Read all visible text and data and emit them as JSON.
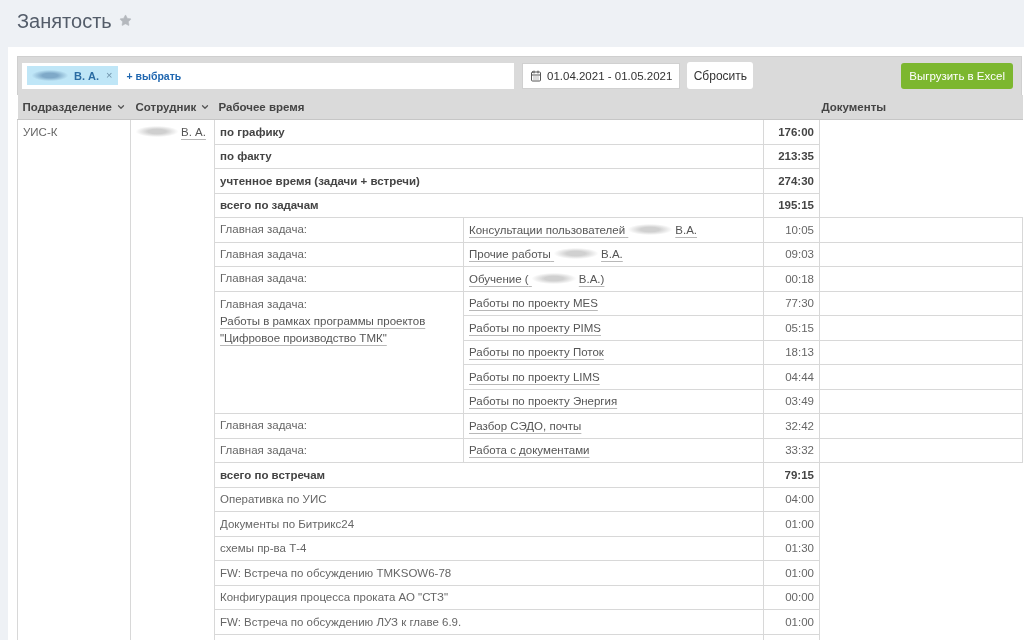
{
  "page": {
    "title": "Занятость",
    "favorite": false
  },
  "toolbar": {
    "filter": {
      "chips": [
        {
          "name_end": "В. А.",
          "redacted": true,
          "remove": "×"
        }
      ],
      "add_link": "+ выбрать"
    },
    "date_range": "01.04.2021 - 01.05.2021",
    "reset_button": "Сбросить",
    "export_button": "Выгрузить в Excel"
  },
  "table": {
    "columns": [
      {
        "label": "Подразделение",
        "sortable": true
      },
      {
        "label": "Сотрудник",
        "sortable": true
      },
      {
        "label": "Рабочее время",
        "sortable": false
      },
      {
        "label": "Документы",
        "sortable": false
      }
    ],
    "department": "УИС-К",
    "employee": {
      "name_end": "В. А.",
      "redacted": true
    },
    "rows": [
      {
        "kind": "total",
        "label": "по графику",
        "time": "176:00"
      },
      {
        "kind": "total",
        "label": "по факту",
        "time": "213:35"
      },
      {
        "kind": "total",
        "label": "учтенное время (задачи + встречи)",
        "time": "274:30"
      },
      {
        "kind": "total",
        "label": "всего по задачам",
        "time": "195:15"
      },
      {
        "kind": "task_group",
        "main_task_label": "Главная задача:",
        "tasks": [
          {
            "title": "Консультации пользователей",
            "redacted": true,
            "title_end": "В.А.",
            "time": "10:05"
          }
        ]
      },
      {
        "kind": "task_group",
        "main_task_label": "Главная задача:",
        "tasks": [
          {
            "title": "Прочие работы",
            "redacted": true,
            "title_end": "В.А.",
            "time": "09:03"
          }
        ]
      },
      {
        "kind": "task_group",
        "main_task_label": "Главная задача:",
        "tasks": [
          {
            "title": "Обучение (",
            "redacted": true,
            "title_end": "В.А.)",
            "time": "00:18"
          }
        ]
      },
      {
        "kind": "task_group",
        "main_task_label": "Главная задача:",
        "main_task": "Работы в рамках программы проектов \"Цифровое производство ТМК\"",
        "tasks": [
          {
            "title": "Работы по проекту MES",
            "time": "77:30"
          },
          {
            "title": "Работы по проекту PIMS",
            "time": "05:15"
          },
          {
            "title": "Работы по проекту Поток",
            "time": "18:13"
          },
          {
            "title": "Работы по проекту LIMS",
            "time": "04:44"
          },
          {
            "title": "Работы по проекту Энергия",
            "time": "03:49"
          }
        ]
      },
      {
        "kind": "task_group",
        "main_task_label": "Главная задача:",
        "tasks": [
          {
            "title": "Разбор СЭДО, почты",
            "time": "32:42"
          }
        ]
      },
      {
        "kind": "task_group",
        "main_task_label": "Главная задача:",
        "tasks": [
          {
            "title": "Работа с документами",
            "time": "33:32"
          }
        ]
      },
      {
        "kind": "total",
        "label": "всего по встречам",
        "time": "79:15"
      },
      {
        "kind": "meeting",
        "label": "Оперативка по УИС",
        "time": "04:00"
      },
      {
        "kind": "meeting",
        "label": "Документы по Битрикс24",
        "time": "01:00"
      },
      {
        "kind": "meeting",
        "label": "схемы пр-ва Т-4",
        "time": "01:30"
      },
      {
        "kind": "meeting",
        "label": "FW: Встреча по обсуждению TMKSOW6-78",
        "time": "01:00"
      },
      {
        "kind": "meeting",
        "label": "Конфигурация процесса проката АО \"СТЗ\"",
        "time": "00:00"
      },
      {
        "kind": "meeting",
        "label": "FW: Встреча по обсуждению ЛУЗ к главе 6.9.",
        "time": "01:00"
      }
    ]
  }
}
